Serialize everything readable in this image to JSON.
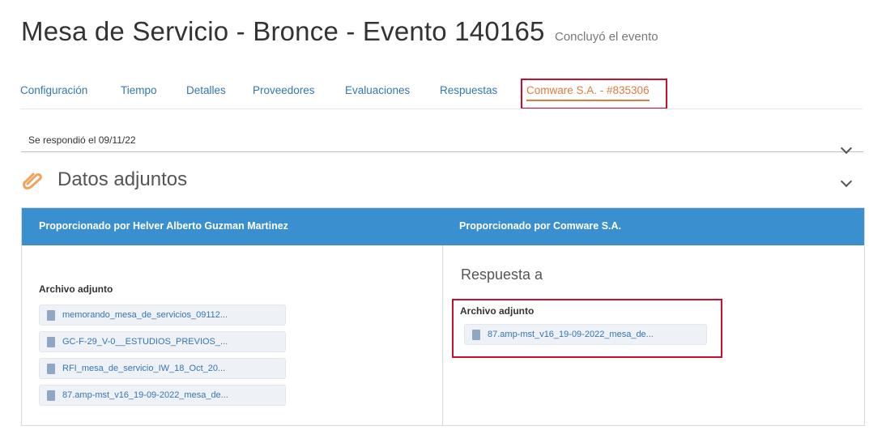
{
  "page": {
    "title": "Mesa de Servicio - Bronce - Evento 140165",
    "status": "Concluyó el evento"
  },
  "tabs": [
    {
      "label": "Configuración"
    },
    {
      "label": "Tiempo"
    },
    {
      "label": "Detalles"
    },
    {
      "label": "Proveedores"
    },
    {
      "label": "Evaluaciones"
    },
    {
      "label": "Respuestas"
    },
    {
      "label": "Comware S.A. - #835306",
      "active": true
    }
  ],
  "response": {
    "responded_text": "Se respondió el 09/11/22"
  },
  "attachments": {
    "title": "Datos adjuntos",
    "left_column": {
      "header": "Proporcionado por Helver Alberto Guzman Martinez",
      "subtitle": "Archivo adjunto",
      "files": [
        "memorando_mesa_de_servicios_09112...",
        "GC-F-29_V-0__ESTUDIOS_PREVIOS_...",
        "RFI_mesa_de_servicio_IW_18_Oct_20...",
        "87.amp-mst_v16_19-09-2022_mesa_de..."
      ]
    },
    "right_column": {
      "header": "Proporcionado por Comware S.A.",
      "response_title": "Respuesta a",
      "subtitle": "Archivo adjunto",
      "files": [
        "87.amp-mst_v16_19-09-2022_mesa_de..."
      ]
    }
  },
  "colors": {
    "link": "#3576b2",
    "active_tab": "#e07a41",
    "header_blue": "#3a8fce",
    "highlight_red": "#c8102e"
  }
}
